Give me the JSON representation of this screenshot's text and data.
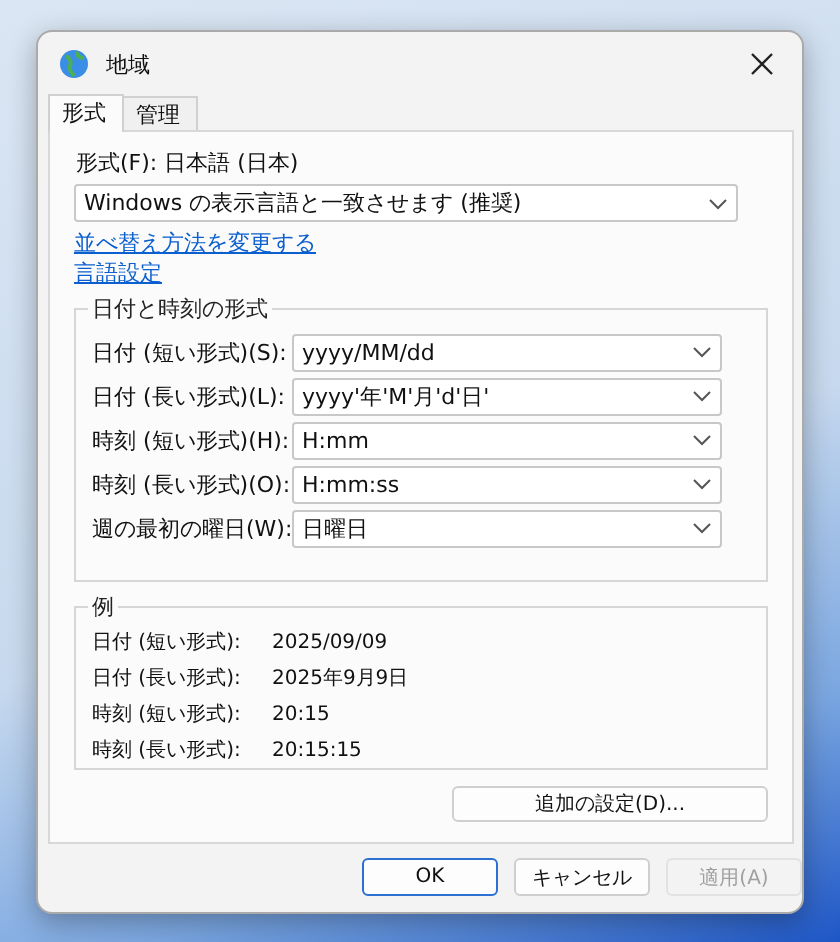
{
  "window": {
    "title": "地域"
  },
  "tabs": [
    {
      "label": "形式",
      "selected": true
    },
    {
      "label": "管理",
      "selected": false
    }
  ],
  "format": {
    "label": "形式(F): 日本語 (日本)",
    "value": "Windows の表示言語と一致させます (推奨)"
  },
  "links": [
    "並べ替え方法を変更する",
    "言語設定"
  ],
  "date_time_group": {
    "title": "日付と時刻の形式",
    "fields": [
      {
        "label": "日付 (短い形式)(S):",
        "value": "yyyy/MM/dd"
      },
      {
        "label": "日付 (長い形式)(L):",
        "value": "yyyy'年'M'月'd'日'"
      },
      {
        "label": "時刻 (短い形式)(H):",
        "value": "H:mm"
      },
      {
        "label": "時刻 (長い形式)(O):",
        "value": "H:mm:ss"
      },
      {
        "label": "週の最初の曜日(W):",
        "value": "日曜日"
      }
    ]
  },
  "example_group": {
    "title": "例",
    "rows": [
      {
        "label": "日付 (短い形式):",
        "value": "2025/09/09"
      },
      {
        "label": "日付 (長い形式):",
        "value": "2025年9月9日"
      },
      {
        "label": "時刻 (短い形式):",
        "value": "20:15"
      },
      {
        "label": "時刻 (長い形式):",
        "value": "20:15:15"
      }
    ]
  },
  "additional_button": "追加の設定(D)...",
  "buttons": [
    {
      "label": "OK",
      "default": true,
      "disabled": false
    },
    {
      "label": "キャンセル",
      "default": false,
      "disabled": false
    },
    {
      "label": "適用(A)",
      "default": false,
      "disabled": true
    }
  ]
}
